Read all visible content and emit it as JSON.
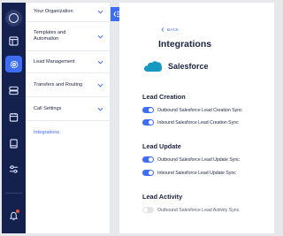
{
  "rail": {
    "items": [
      {
        "name": "layout-icon"
      },
      {
        "name": "gear-icon",
        "active": true
      },
      {
        "name": "server-icon"
      },
      {
        "name": "calendar-icon"
      },
      {
        "name": "book-icon"
      },
      {
        "name": "sliders-icon"
      }
    ],
    "bell": {
      "name": "bell-icon",
      "has_notification": true
    }
  },
  "menu": {
    "items": [
      {
        "label": "Your Organization",
        "expandable": true
      },
      {
        "label": "Templates and Automation",
        "expandable": true
      },
      {
        "label": "Lead Management",
        "expandable": true
      },
      {
        "label": "Transfers and Routing",
        "expandable": true
      },
      {
        "label": "Call Settings",
        "expandable": true
      },
      {
        "label": "Integrations",
        "expandable": false,
        "active": true
      }
    ]
  },
  "content": {
    "back_label": "BACK",
    "title": "Integrations",
    "brand_logo_text": "salesforce",
    "brand_name": "Salesforce",
    "sections": [
      {
        "title": "Lead Creation",
        "toggles": [
          {
            "label": "Outbound Salesforce Lead Creation Sync",
            "on": true
          },
          {
            "label": "Inbound Salesforce Lead Creation Sync",
            "on": true
          }
        ]
      },
      {
        "title": "Lead Update",
        "toggles": [
          {
            "label": "Outbound Salesforce Lead Update Sync",
            "on": true
          },
          {
            "label": "Inbound Salesforce Lead Update Sync",
            "on": true
          }
        ]
      },
      {
        "title": "Lead Activity",
        "toggles": [
          {
            "label": "Outbound Salesforce Lead Activity Sync",
            "on": false
          }
        ]
      }
    ]
  },
  "colors": {
    "rail_bg": "#14214f",
    "accent": "#3d6ef5",
    "text": "#1c2340",
    "notification": "#e8533f",
    "salesforce_blue": "#1798c1"
  }
}
